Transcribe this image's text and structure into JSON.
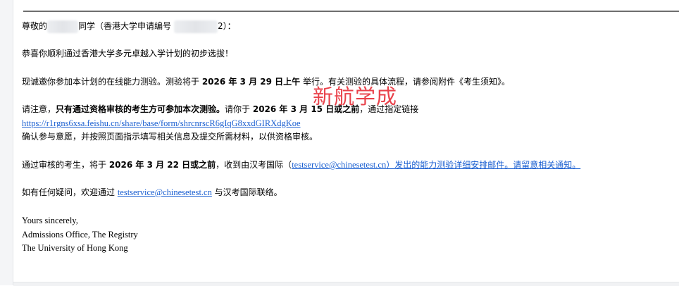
{
  "email": {
    "greeting": {
      "prefix": "尊敬的",
      "middle": "同学（香港大学申请编号",
      "suffix": "2）："
    },
    "p_congrats": "恭喜你顺利通过香港大学多元卓越入学计划的初步选拔！",
    "p_invite": {
      "a": "现诚邀你参加本计划的在线能力测验。测验将于 ",
      "date": "2026 年 3 月 29 日上午",
      "b": " 举行。有关测验的具体流程，请参阅附件《考生须知》。"
    },
    "p_notice": {
      "a": "请注意，",
      "bold": "只有通过资格审核的考生方可参加本次测验。",
      "b": "请你于 ",
      "date": "2026 年 3 月 15 日或之前",
      "c": "，通过指定链接",
      "link": "https://r1rgns6xsa.feishu.cn/share/base/form/shrcnrscR6gIqG8xxdGIRXdgKoe",
      "d": "确认参与意愿，并按照页面指示填写相关信息及提交所需材料，以供资格审核。"
    },
    "p_passed": {
      "a": "通过审核的考生，将于 ",
      "date": "2026 年 3 月 22 日或之前",
      "b": "，收到由汉考国际（",
      "email": "testservice@chinesetest.cn",
      "c": "）发出的能力测验详细安排邮件。请留意相关通知。"
    },
    "p_contact": {
      "a": "如有任何疑问，欢迎通过 ",
      "email": "testservice@chinesetest.cn",
      "b": " 与汉考国际联络。"
    },
    "signoff": [
      "Yours sincerely,",
      "Admissions Office, The Registry",
      "The University of Hong Kong"
    ]
  },
  "watermark": "新航学成",
  "colors": {
    "link": "#1a5fd1",
    "watermark": "#e8323c",
    "separator": "#6e6e6e"
  }
}
